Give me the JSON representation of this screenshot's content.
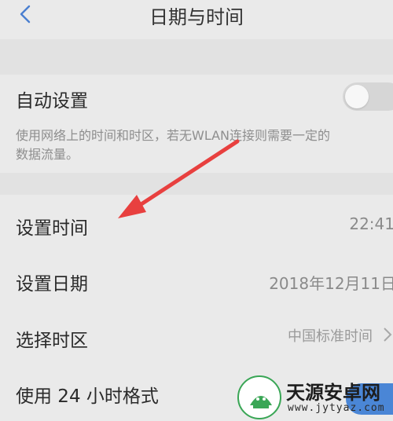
{
  "header": {
    "title": "日期与时间",
    "back_icon": "chevron-left-icon"
  },
  "auto_setting": {
    "label": "自动设置",
    "toggle_state": "off",
    "description_line1": "使用网络上的时间和时区，若无WLAN连接则需要一定的",
    "description_line2": "数据流量。"
  },
  "set_time": {
    "label": "设置时间",
    "value": "22:41"
  },
  "set_date": {
    "label": "设置日期",
    "value": "2018年12月11日"
  },
  "timezone": {
    "label": "选择时区",
    "value": "中国标准时间"
  },
  "hour24": {
    "label": "使用 24 小时格式",
    "toggle_state": "on"
  },
  "annotation": {
    "arrow_color": "#e8403f"
  },
  "watermark": {
    "name": "天源安卓网",
    "url": "www.jytyaz.com"
  },
  "colors": {
    "background": "#eaeaea",
    "accent": "#4a86d6",
    "back_icon": "#4a7fd0"
  }
}
